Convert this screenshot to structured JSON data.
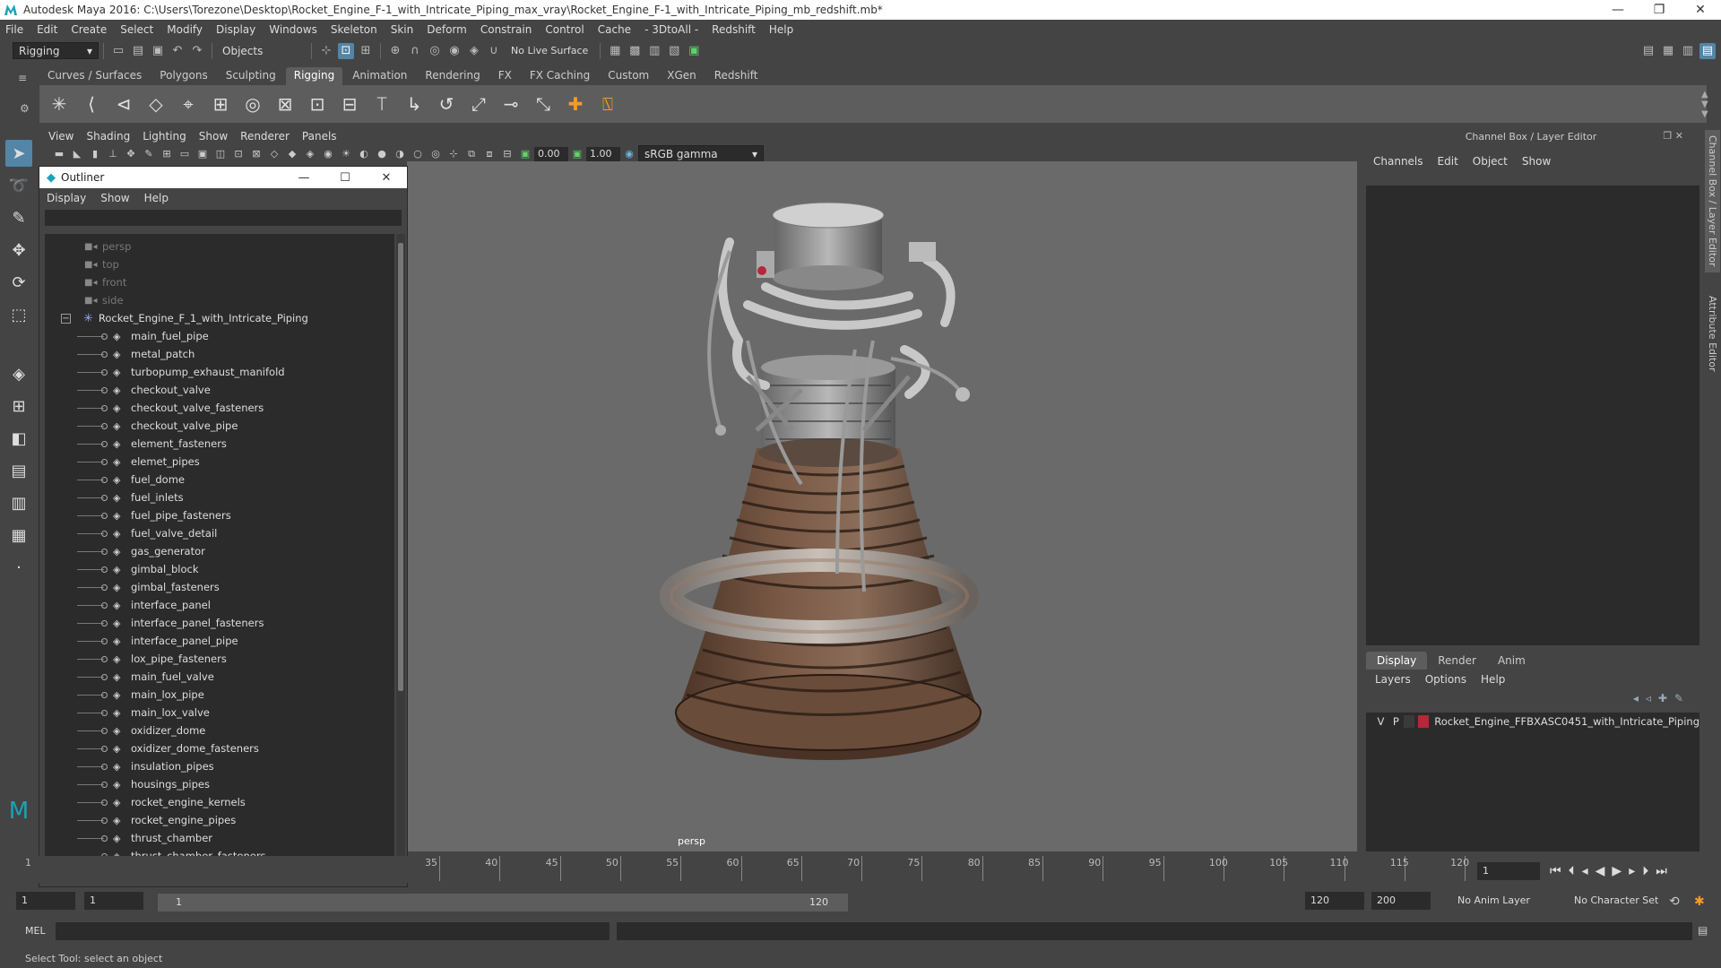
{
  "window": {
    "title": "Autodesk Maya 2016: C:\\Users\\Torezone\\Desktop\\Rocket_Engine_F-1_with_Intricate_Piping_max_vray\\Rocket_Engine_F-1_with_Intricate_Piping_mb_redshift.mb*",
    "minimize": "—",
    "restore": "❐",
    "close": "✕"
  },
  "menubar": [
    "File",
    "Edit",
    "Create",
    "Select",
    "Modify",
    "Display",
    "Windows",
    "Skeleton",
    "Skin",
    "Deform",
    "Constrain",
    "Control",
    "Cache",
    "- 3DtoAll -",
    "Redshift",
    "Help"
  ],
  "statusbar": {
    "mode": "Rigging",
    "selection_mode": "Objects",
    "live_surface": "No Live Surface"
  },
  "shelf_tabs": [
    {
      "label": "Curves / Surfaces",
      "active": false
    },
    {
      "label": "Polygons",
      "active": false
    },
    {
      "label": "Sculpting",
      "active": false
    },
    {
      "label": "Rigging",
      "active": true
    },
    {
      "label": "Animation",
      "active": false
    },
    {
      "label": "Rendering",
      "active": false
    },
    {
      "label": "FX",
      "active": false
    },
    {
      "label": "FX Caching",
      "active": false
    },
    {
      "label": "Custom",
      "active": false
    },
    {
      "label": "XGen",
      "active": false
    },
    {
      "label": "Redshift",
      "active": false
    }
  ],
  "panel_menu": [
    "View",
    "Shading",
    "Lighting",
    "Show",
    "Renderer",
    "Panels"
  ],
  "panel_tools": {
    "exposure": "0.00",
    "gamma": "1.00",
    "color_space": "sRGB gamma"
  },
  "viewport": {
    "camera_label": "persp"
  },
  "outliner": {
    "title": "Outliner",
    "menu": [
      "Display",
      "Show",
      "Help"
    ],
    "cameras": [
      "persp",
      "top",
      "front",
      "side"
    ],
    "group": "Rocket_Engine_F_1_with_Intricate_Piping",
    "children": [
      "main_fuel_pipe",
      "metal_patch",
      "turbopump_exhaust_manifold",
      "checkout_valve",
      "checkout_valve_fasteners",
      "checkout_valve_pipe",
      "element_fasteners",
      "elemet_pipes",
      "fuel_dome",
      "fuel_inlets",
      "fuel_pipe_fasteners",
      "fuel_valve_detail",
      "gas_generator",
      "gimbal_block",
      "gimbal_fasteners",
      "interface_panel",
      "interface_panel_fasteners",
      "interface_panel_pipe",
      "lox_pipe_fasteners",
      "main_fuel_valve",
      "main_lox_pipe",
      "main_lox_valve",
      "oxidizer_dome",
      "oxidizer_dome_fasteners",
      "insulation_pipes",
      "housings_pipes",
      "rocket_engine_kernels",
      "rocket_engine_pipes",
      "thrust_chamber",
      "thrust_chamber_fasteners"
    ]
  },
  "channel_box": {
    "title": "Channel Box / Layer Editor",
    "menu": [
      "Channels",
      "Edit",
      "Object",
      "Show"
    ]
  },
  "side_tabs": [
    "Channel Box / Layer Editor",
    "Attribute Editor"
  ],
  "layer_editor": {
    "tabs": [
      {
        "label": "Display",
        "active": true
      },
      {
        "label": "Render",
        "active": false
      },
      {
        "label": "Anim",
        "active": false
      }
    ],
    "menu": [
      "Layers",
      "Options",
      "Help"
    ],
    "layer": {
      "v": "V",
      "p": "P",
      "name": "Rocket_Engine_FFBXASC0451_with_Intricate_Piping",
      "color": "#b5283a"
    }
  },
  "timeline": {
    "ticks": [
      "35",
      "40",
      "45",
      "50",
      "55",
      "60",
      "65",
      "70",
      "75",
      "80",
      "85",
      "90",
      "95",
      "100",
      "105",
      "110",
      "115",
      "120"
    ],
    "start_label": "1",
    "current_frame": "1"
  },
  "range": {
    "start": "1",
    "anim_start": "1",
    "slider_start": "1",
    "slider_end": "120",
    "end": "120",
    "anim_end": "200",
    "anim_layer": "No Anim Layer",
    "character_set": "No Character Set"
  },
  "command_line": {
    "label": "MEL"
  },
  "help_line": "Select Tool: select an object"
}
